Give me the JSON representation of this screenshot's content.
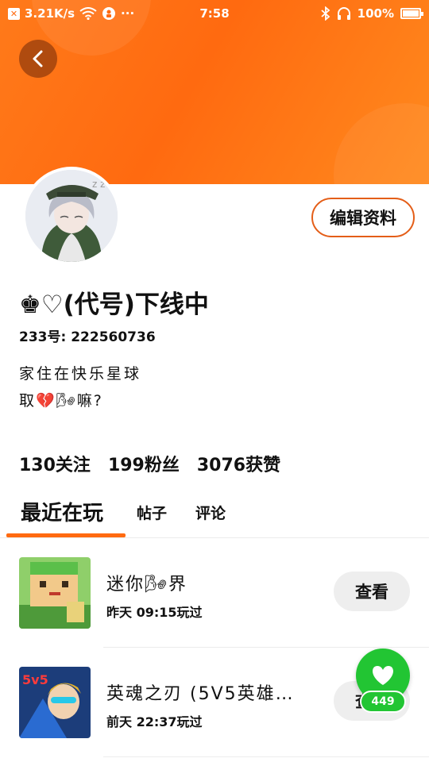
{
  "status_bar": {
    "network_speed": "3.21K/s",
    "dots": "···",
    "time": "7:58",
    "battery": "100%",
    "battery_level": 1.0
  },
  "profile": {
    "nickname": "♚♡(代号)下线中",
    "uid": "233号: 222560736",
    "bio_line1": "家住在快乐星球",
    "bio_line2": "取💔🌬嘛?",
    "edit_label": "编辑资料"
  },
  "stats": {
    "following": "130关注",
    "followers": "199粉丝",
    "likes": "3076获赞"
  },
  "tabs": {
    "recent": "最近在玩",
    "posts": "帖子",
    "comments": "评论"
  },
  "games": [
    {
      "name": "迷你🌬界",
      "time": "昨天 09:15玩过",
      "action": "查看"
    },
    {
      "name": "英魂之刃 (5V5英雄…",
      "time": "前天 22:37玩过",
      "action": "查看"
    }
  ],
  "like_fab": {
    "count": "449"
  },
  "colors": {
    "accent": "#ff6a10",
    "like_green": "#22c533"
  }
}
